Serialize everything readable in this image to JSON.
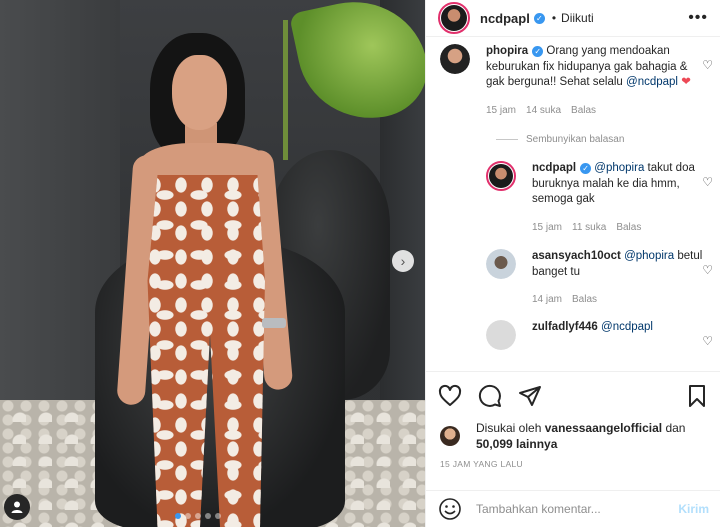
{
  "post": {
    "username": "ncdpapl",
    "follow_status": "Diikuti",
    "separator": "•",
    "more_icon": "more-horizontal-icon",
    "carousel": {
      "next_glyph": "›",
      "slides": 5,
      "active_slide": 0
    }
  },
  "comments": [
    {
      "username": "phopira",
      "verified": true,
      "text": "Orang yang mendoakan keburukan fix hidupanya gak bahagia & gak berguna!! Sehat selalu",
      "mention": "@ncdpapl",
      "emoji": "❤",
      "time": "15 jam",
      "likes": "14 suka",
      "reply_label": "Balas"
    }
  ],
  "hide_replies_label": "Sembunyikan balasan",
  "replies": [
    {
      "username": "ncdpapl",
      "verified": true,
      "mention": "@phopira",
      "text": "takut doa buruknya malah ke dia hmm, semoga gak",
      "time": "15 jam",
      "likes": "11 suka",
      "reply_label": "Balas"
    },
    {
      "username": "asansyach10oct",
      "mention": "@phopira",
      "text": "betul banget tu",
      "time": "14 jam",
      "reply_label": "Balas"
    },
    {
      "username": "zulfadlyf446",
      "mention": "@ncdpapl",
      "text": ""
    }
  ],
  "likes": {
    "prefix": "Disukai oleh",
    "user": "vanessaangelofficial",
    "conj": "dan",
    "count": "50,099 lainnya"
  },
  "timestamp": "15 JAM YANG LALU",
  "add_comment": {
    "placeholder": "Tambahkan komentar...",
    "post_label": "Kirim"
  },
  "icons": {
    "verified_glyph": "✓",
    "heart_outline": "♡",
    "user_tag": "👤"
  }
}
